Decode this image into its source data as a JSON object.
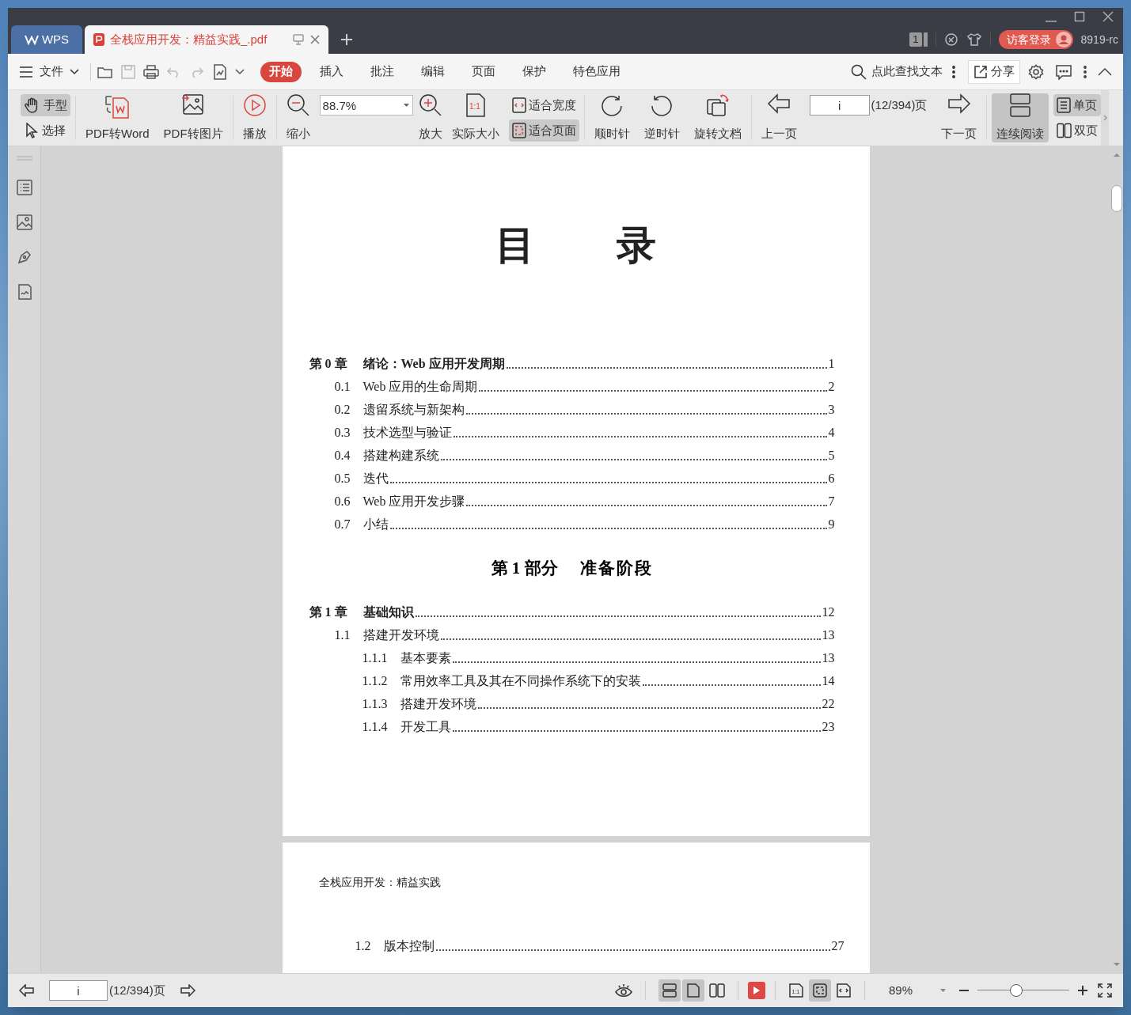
{
  "tabs": [
    {
      "kind": "home",
      "label": "WPS",
      "selected": false
    },
    {
      "kind": "document",
      "label": "全栈应用开发：精益实践_.pdf",
      "selected": true
    }
  ],
  "title_bar": {
    "page_badge": "1",
    "login_button": "访客登录",
    "user": "8919-rc"
  },
  "menu": {
    "file": "文件",
    "items": [
      {
        "label": "开始",
        "selected": true
      },
      {
        "label": "插入",
        "selected": false
      },
      {
        "label": "批注",
        "selected": false
      },
      {
        "label": "编辑",
        "selected": false
      },
      {
        "label": "页面",
        "selected": false
      },
      {
        "label": "保护",
        "selected": false
      },
      {
        "label": "特色应用",
        "selected": false
      }
    ],
    "search_placeholder": "点此查找文本",
    "share": "分享"
  },
  "toolbar": {
    "hand": {
      "label": "手型",
      "selected": true
    },
    "select": {
      "label": "选择",
      "selected": false
    },
    "pdf_to_word": "PDF转Word",
    "pdf_to_image": "PDF转图片",
    "play": "播放",
    "zoom_out": "缩小",
    "zoom_value": "88.7%",
    "zoom_in": "放大",
    "actual_size": "实际大小",
    "actual_size_glyph": "1:1",
    "fit_width": {
      "label": "适合宽度",
      "selected": false
    },
    "fit_page": {
      "label": "适合页面",
      "selected": true
    },
    "clockwise": "顺时针",
    "counterclockwise": "逆时针",
    "rotate_document": "旋转文档",
    "previous_page": "上一页",
    "page_value": "i",
    "page_count": "(12/394)页",
    "next_page": "下一页",
    "continuous": {
      "label": "连续阅读",
      "selected": true
    },
    "single_page": {
      "label": "单页",
      "selected": true
    },
    "double_page": {
      "label": "双页",
      "selected": false
    }
  },
  "document": {
    "pages": [
      {
        "title": "目 录",
        "blocks": [
          {
            "kind": "chapter",
            "number": "第 0 章",
            "title": "绪论：Web 应用开发周期",
            "page": "1"
          },
          {
            "kind": "section",
            "number": "0.1",
            "title": "Web 应用的生命周期",
            "page": "2"
          },
          {
            "kind": "section",
            "number": "0.2",
            "title": "遗留系统与新架构",
            "page": "3"
          },
          {
            "kind": "section",
            "number": "0.3",
            "title": "技术选型与验证",
            "page": "4"
          },
          {
            "kind": "section",
            "number": "0.4",
            "title": "搭建构建系统",
            "page": "5"
          },
          {
            "kind": "section",
            "number": "0.5",
            "title": "迭代",
            "page": "6"
          },
          {
            "kind": "section",
            "number": "0.6",
            "title": "Web 应用开发步骤",
            "page": "7"
          },
          {
            "kind": "section",
            "number": "0.7",
            "title": "小结",
            "page": "9"
          },
          {
            "kind": "part",
            "number": "第 1 部分",
            "title": "准备阶段"
          },
          {
            "kind": "chapter",
            "number": "第 1 章",
            "title": "基础知识",
            "page": "12"
          },
          {
            "kind": "section",
            "number": "1.1",
            "title": "搭建开发环境",
            "page": "13"
          },
          {
            "kind": "subsection",
            "number": "1.1.1",
            "title": "基本要素",
            "page": "13"
          },
          {
            "kind": "subsection",
            "number": "1.1.2",
            "title": "常用效率工具及其在不同操作系统下的安装",
            "page": "14"
          },
          {
            "kind": "subsection",
            "number": "1.1.3",
            "title": "搭建开发环境",
            "page": "22"
          },
          {
            "kind": "subsection",
            "number": "1.1.4",
            "title": "开发工具",
            "page": "23"
          }
        ]
      },
      {
        "header": "全栈应用开发：精益实践",
        "blocks": [
          {
            "kind": "section",
            "number": "1.2",
            "title": "版本控制",
            "page": "27"
          }
        ]
      }
    ]
  },
  "status_bar": {
    "page_value": "i",
    "page_count": "(12/394)页",
    "continuous": {
      "selected": true
    },
    "single_page": {
      "selected": true
    },
    "double_page": {
      "selected": false
    },
    "actual_size": {
      "selected": false,
      "glyph": "1:1"
    },
    "fit_page": {
      "selected": true
    },
    "fit_width": {
      "selected": false
    },
    "zoom_value": "89%",
    "zoom_slider": {
      "level": 0.42
    }
  }
}
